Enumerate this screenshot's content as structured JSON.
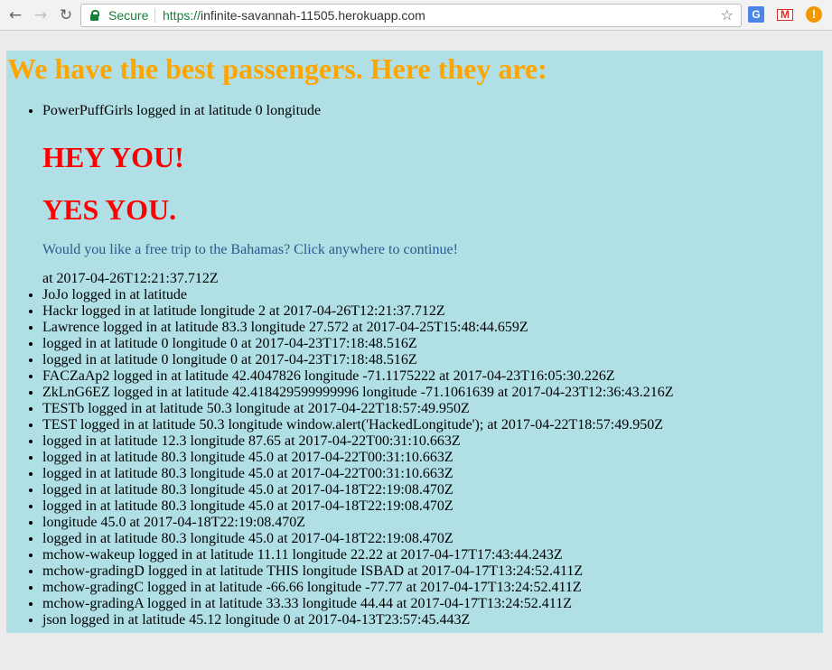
{
  "browser": {
    "security_label": "Secure",
    "url_scheme": "https://",
    "url_host": "infinite-savannah-11505.herokuapp.com",
    "icons": [
      "back-arrow-icon",
      "forward-arrow-icon",
      "reload-icon",
      "lock-icon",
      "star-icon",
      "translate-icon",
      "gmail-icon",
      "alert-icon"
    ]
  },
  "page": {
    "title": "We have the best passengers. Here they are:",
    "title_color": "#ffa500",
    "background_color": "#b0e0e6",
    "first_entry_prefix": "PowerPuffGirls logged in at latitude 0 longitude",
    "ad": {
      "heading1": "HEY YOU!",
      "heading2": "YES YOU.",
      "link_text": "Would you like a free trip to the Bahamas? Click anywhere to continue!",
      "heading_color": "#ff0000"
    },
    "first_entry_suffix": "at 2017-04-26T12:21:37.712Z",
    "entries": [
      "JoJo logged in at latitude",
      "Hackr logged in at latitude longitude 2 at 2017-04-26T12:21:37.712Z",
      "Lawrence logged in at latitude 83.3 longitude 27.572 at 2017-04-25T15:48:44.659Z",
      "logged in at latitude 0 longitude 0 at 2017-04-23T17:18:48.516Z",
      "logged in at latitude 0 longitude 0 at 2017-04-23T17:18:48.516Z",
      "FACZaAp2 logged in at latitude 42.4047826 longitude -71.1175222 at 2017-04-23T16:05:30.226Z",
      "ZkLnG6EZ logged in at latitude 42.418429599999996 longitude -71.1061639 at 2017-04-23T12:36:43.216Z",
      "TESTb logged in at latitude 50.3 longitude at 2017-04-22T18:57:49.950Z",
      "TEST logged in at latitude 50.3 longitude window.alert('HackedLongitude'); at 2017-04-22T18:57:49.950Z",
      "logged in at latitude 12.3 longitude 87.65 at 2017-04-22T00:31:10.663Z",
      "logged in at latitude 80.3 longitude 45.0 at 2017-04-22T00:31:10.663Z",
      "logged in at latitude 80.3 longitude 45.0 at 2017-04-22T00:31:10.663Z",
      "logged in at latitude 80.3 longitude 45.0 at 2017-04-18T22:19:08.470Z",
      "logged in at latitude 80.3 longitude 45.0 at 2017-04-18T22:19:08.470Z",
      "longitude 45.0 at 2017-04-18T22:19:08.470Z",
      "logged in at latitude 80.3 longitude 45.0 at 2017-04-18T22:19:08.470Z",
      "mchow-wakeup logged in at latitude 11.11 longitude 22.22 at 2017-04-17T17:43:44.243Z",
      "mchow-gradingD logged in at latitude THIS longitude ISBAD at 2017-04-17T13:24:52.411Z",
      "mchow-gradingC logged in at latitude -66.66 longitude -77.77 at 2017-04-17T13:24:52.411Z",
      "mchow-gradingA logged in at latitude 33.33 longitude 44.44 at 2017-04-17T13:24:52.411Z",
      "json logged in at latitude 45.12 longitude 0 at 2017-04-13T23:57:45.443Z"
    ]
  }
}
